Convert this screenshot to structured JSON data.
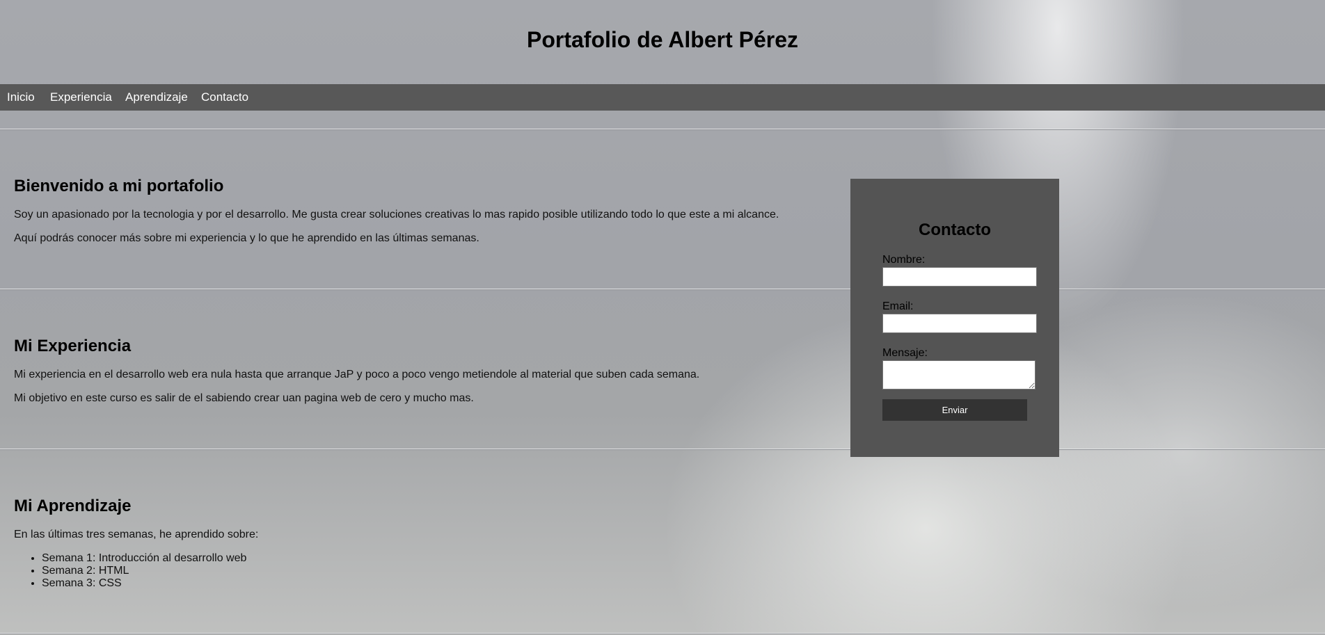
{
  "header": {
    "title": "Portafolio de Albert Pérez"
  },
  "nav": {
    "items": [
      "Inicio",
      "Experiencia",
      "Aprendizaje",
      "Contacto"
    ]
  },
  "welcome": {
    "heading": "Bienvenido a mi portafolio",
    "p1": "Soy un apasionado por la tecnologia y por el desarrollo. Me gusta crear soluciones creativas lo mas rapido posible utilizando todo lo que este a mi alcance.",
    "p2": "Aquí podrás conocer más sobre mi experiencia y lo que he aprendido en las últimas semanas."
  },
  "experience": {
    "heading": "Mi Experiencia",
    "p1": "Mi experiencia en el desarrollo web era nula hasta que arranque JaP y poco a poco vengo metiendole al material que suben cada semana.",
    "p2": "Mi objetivo en este curso es salir de el sabiendo crear uan pagina web de cero y mucho mas."
  },
  "learning": {
    "heading": "Mi Aprendizaje",
    "intro": "En las últimas tres semanas, he aprendido sobre:",
    "items": [
      "Semana 1: Introducción al desarrollo web",
      "Semana 2: HTML",
      "Semana 3: CSS"
    ]
  },
  "contact_form": {
    "heading": "Contacto",
    "name_label": "Nombre:",
    "email_label": "Email:",
    "message_label": "Mensaje:",
    "submit_label": "Enviar"
  },
  "colors": {
    "nav_bg": "#585858",
    "contact_bg": "#545454",
    "button_bg": "#333333"
  }
}
